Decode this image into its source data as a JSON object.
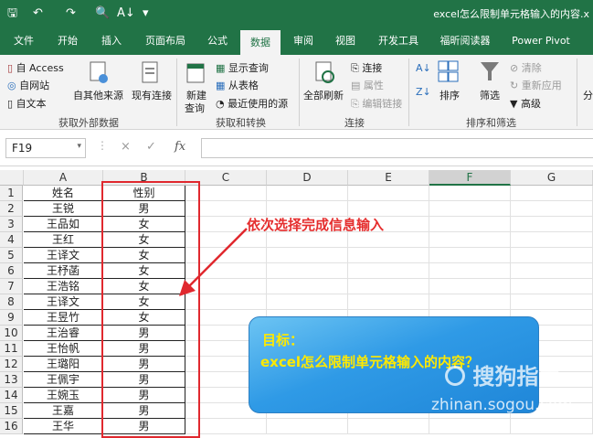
{
  "window": {
    "title": "excel怎么限制单元格输入的内容.x"
  },
  "menu_tabs": [
    "文件",
    "开始",
    "插入",
    "页面布局",
    "公式",
    "数据",
    "审阅",
    "视图",
    "开发工具",
    "福昕阅读器",
    "Power Pivot"
  ],
  "active_tab": "数据",
  "ribbon": {
    "external": {
      "access": "自 Access",
      "web": "自网站",
      "text": "自文本",
      "other": "自其他来源",
      "existing": "现有连接",
      "group": "获取外部数据"
    },
    "transform": {
      "new_query": "新建",
      "new_query_2": "查询",
      "show_queries": "显示查询",
      "from_table": "从表格",
      "recent": "最近使用的源",
      "group": "获取和转换"
    },
    "connections": {
      "refresh_all": "全部刷新",
      "connections": "连接",
      "properties": "属性",
      "edit_links": "编辑链接",
      "group": "连接"
    },
    "sort_filter": {
      "sort": "排序",
      "filter": "筛选",
      "clear": "清除",
      "reapply": "重新应用",
      "advanced": "高级",
      "group": "排序和筛选",
      "split_partial": "分"
    }
  },
  "formula_bar": {
    "name_box": "F19",
    "fx": "fx",
    "cancel": "×",
    "confirm": "✓"
  },
  "sheet": {
    "columns": [
      "A",
      "B",
      "C",
      "D",
      "E",
      "F",
      "G"
    ],
    "selected_column": "F",
    "rows": [
      "1",
      "2",
      "3",
      "4",
      "5",
      "6",
      "7",
      "8",
      "9",
      "10",
      "11",
      "12",
      "13",
      "14",
      "15",
      "16"
    ],
    "cells": [
      [
        "姓名",
        "性别"
      ],
      [
        "王锐",
        "男"
      ],
      [
        "王品如",
        "女"
      ],
      [
        "王红",
        "女"
      ],
      [
        "王译文",
        "女"
      ],
      [
        "王杼菡",
        "女"
      ],
      [
        "王浩铭",
        "女"
      ],
      [
        "王译文",
        "女"
      ],
      [
        "王昱竹",
        "女"
      ],
      [
        "王治睿",
        "男"
      ],
      [
        "王怡帆",
        "男"
      ],
      [
        "王璐阳",
        "男"
      ],
      [
        "王佩宇",
        "男"
      ],
      [
        "王婉玉",
        "男"
      ],
      [
        "王嘉",
        "男"
      ],
      [
        "王华",
        "男"
      ]
    ]
  },
  "annotation": {
    "text": "依次选择完成信息输入",
    "color": "#e52e2e"
  },
  "callout": {
    "line1": "目标：",
    "line2": "excel怎么限制单元格输入的内容？"
  },
  "watermark": {
    "brand": "搜狗指南",
    "url": "zhinan.sogou.com"
  },
  "colors": {
    "excel_green": "#217346",
    "red_box": "#e0282e",
    "callout_blue": "#2f9ae6",
    "callout_text": "#ffe900"
  }
}
